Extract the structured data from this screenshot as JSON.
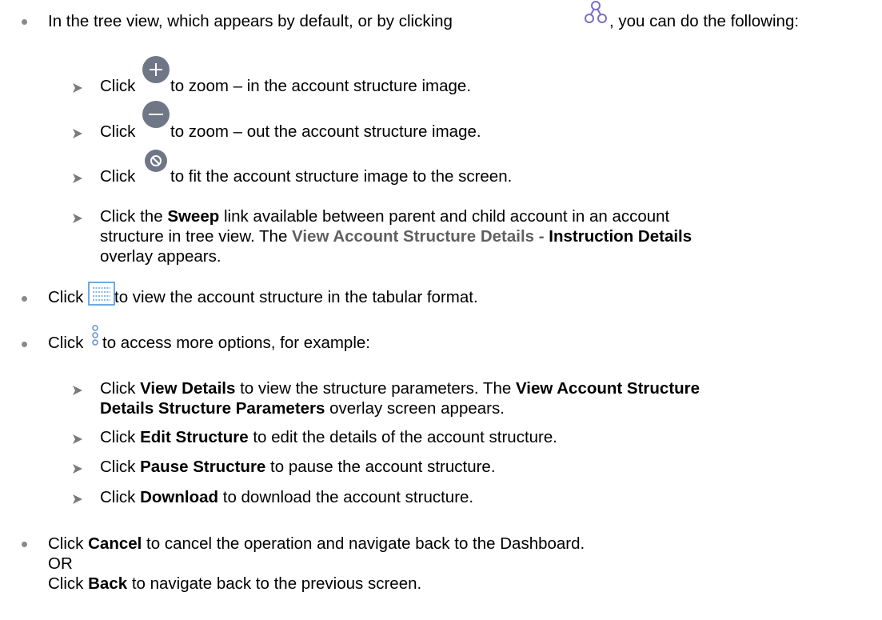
{
  "items": {
    "tree_intro": {
      "before": "In the tree view, which appears by default, or by clicking ",
      "after": ", you can do the following:",
      "icon": "tree-view-icon"
    },
    "zoom_in": {
      "click": "Click ",
      "text": "to zoom – in the account structure image.",
      "icon": "zoom-in-icon"
    },
    "zoom_out": {
      "click": "Click ",
      "text": "to zoom – out the account structure image.",
      "icon": "zoom-out-icon"
    },
    "fit": {
      "click": "Click ",
      "text": "to fit the account structure image to the screen.",
      "icon": "fit-to-screen-icon"
    },
    "sweep": {
      "l1a": "Click the ",
      "l1b": "Sweep",
      "l1c": " link available between parent and child account in an account",
      "l2a": "structure in tree view. The ",
      "l2b": "View Account Structure Details",
      "l2c": " - ",
      "l2d": "Instruction Details",
      "l3": "overlay appears."
    },
    "tabular": {
      "click": "Click ",
      "text": " to view the account structure in the tabular format.",
      "icon": "table-view-icon"
    },
    "more": {
      "click": "Click ",
      "text": " to access more options, for example:",
      "icon": "more-options-icon"
    },
    "view_details": {
      "l1a": "Click ",
      "l1b": "View Details",
      "l1c": " to view the structure parameters. The ",
      "l1d": "View Account Structure",
      "l2a": "Details Structure Parameters",
      "l2b": " overlay screen appears."
    },
    "edit": {
      "a": "Click ",
      "b": "Edit Structure",
      "c": " to edit the details of the account structure."
    },
    "pause": {
      "a": "Click ",
      "b": "Pause Structure",
      "c": " to pause the account structure."
    },
    "download": {
      "a": "Click ",
      "b": "Download",
      "c": " to download the account structure."
    },
    "cancel": {
      "a": "Click ",
      "b": "Cancel",
      "c": " to cancel the operation and navigate back to the Dashboard."
    },
    "or": "OR",
    "back": {
      "a": "Click ",
      "b": "Back",
      "c": " to navigate back to the previous screen."
    }
  },
  "colors": {
    "icon_circle": "#6f7686",
    "tree_icon": "#7a6fc2",
    "table_icon": "#3d8fd8",
    "bullet": "#8a8a8a"
  }
}
